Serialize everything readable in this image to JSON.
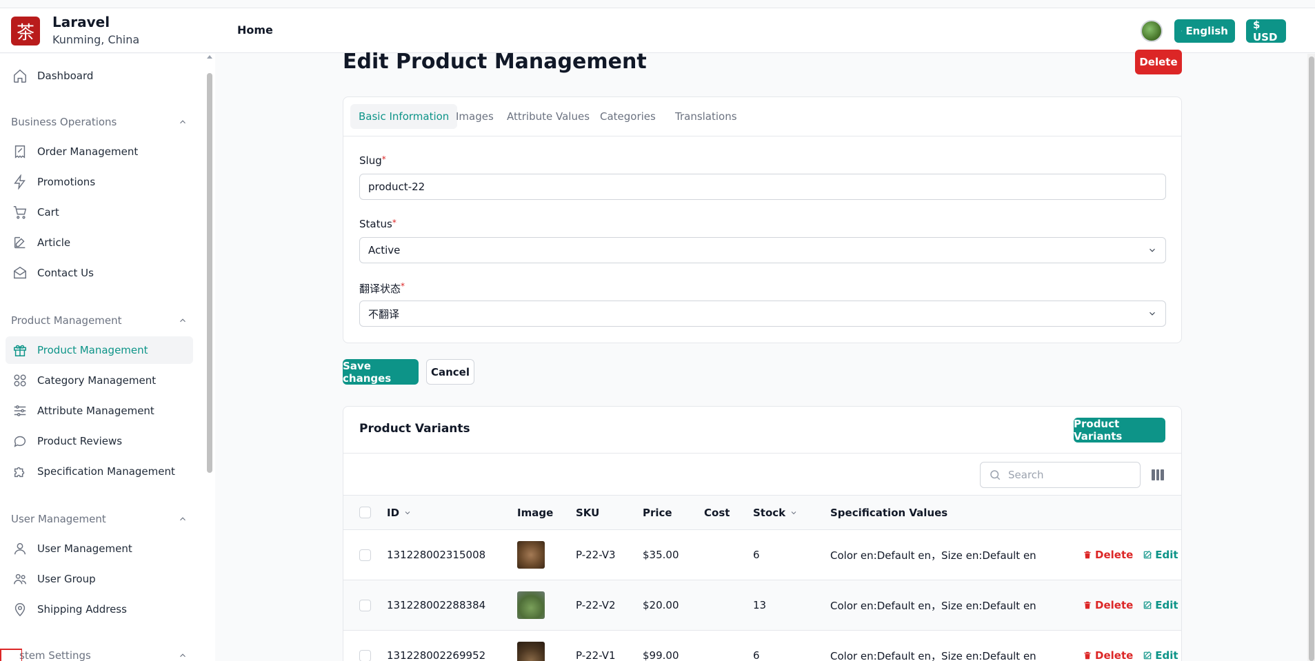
{
  "brand": {
    "logo_char": "茶",
    "title": "Laravel",
    "subtitle": "Kunming, China"
  },
  "topnav": {
    "home": "Home",
    "language": "English",
    "currency": "$ USD"
  },
  "sidebar": {
    "dashboard": "Dashboard",
    "sections": [
      {
        "title": "Business Operations",
        "items": [
          "Order Management",
          "Promotions",
          "Cart",
          "Article",
          "Contact Us"
        ]
      },
      {
        "title": "Product Management",
        "items": [
          "Product Management",
          "Category Management",
          "Attribute Management",
          "Product Reviews",
          "Specification Management"
        ]
      },
      {
        "title": "User Management",
        "items": [
          "User Management",
          "User Group",
          "Shipping Address"
        ]
      },
      {
        "title": "stem Settings"
      }
    ],
    "active_item": "Product Management"
  },
  "page": {
    "title": "Edit Product Management",
    "delete_label": "Delete",
    "tabs": [
      "Basic Information",
      "Images",
      "Attribute Values",
      "Categories",
      "Translations"
    ],
    "active_tab": "Basic Information",
    "fields": {
      "slug": {
        "label": "Slug",
        "required": "*",
        "value": "product-22"
      },
      "status": {
        "label": "Status",
        "required": "*",
        "value": "Active"
      },
      "translation_status": {
        "label": "翻译状态",
        "required": "*",
        "value": "不翻译"
      }
    },
    "save_label": "Save changes",
    "cancel_label": "Cancel"
  },
  "variants": {
    "title": "Product Variants",
    "button_label": "Product Variants",
    "search_placeholder": "Search",
    "columns": [
      "ID",
      "Image",
      "SKU",
      "Price",
      "Cost",
      "Stock",
      "Specification Values"
    ],
    "rows": [
      {
        "id": "131228002315008",
        "sku": "P-22-V3",
        "price": "$35.00",
        "cost": "",
        "stock": "6",
        "spec": "Color en:Default en，Size en:Default en",
        "image": "dried-tea"
      },
      {
        "id": "131228002288384",
        "sku": "P-22-V2",
        "price": "$20.00",
        "cost": "",
        "stock": "13",
        "spec": "Color en:Default en，Size en:Default en",
        "image": "tea-leaves"
      },
      {
        "id": "131228002269952",
        "sku": "P-22-V1",
        "price": "$99.00",
        "cost": "",
        "stock": "6",
        "spec": "Color en:Default en，Size en:Default en",
        "image": "tea-cake"
      }
    ],
    "row_actions": {
      "delete": "Delete",
      "edit": "Edit"
    }
  },
  "colors": {
    "accent": "#0d9488",
    "danger": "#dc2626",
    "brand": "#b91c1c"
  }
}
